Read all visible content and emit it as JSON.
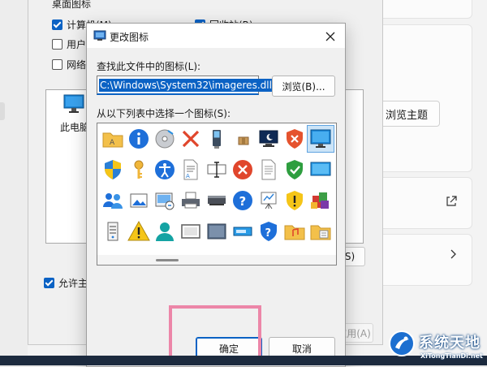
{
  "background_dialog": {
    "group_label": "桌面图标",
    "checkboxes": [
      {
        "label": "计算机(M)",
        "checked": true
      },
      {
        "label": "回收站(R)",
        "checked": true
      },
      {
        "label": "用户的",
        "checked": false
      },
      {
        "label": "网络(",
        "checked": false
      }
    ],
    "preview_label": "此电脑",
    "change_button_suffix": "S)",
    "allow_themes_label": "允许主题",
    "allow_themes_checked": true,
    "apply_label": "应用(A)"
  },
  "settings_panel": {
    "browse_themes_label": "浏览主题"
  },
  "dialog": {
    "title": "更改图标",
    "find_label": "查找此文件中的图标(L):",
    "path_value": "C:\\Windows\\System32\\imageres.dll",
    "browse_label": "浏览(B)...",
    "select_label": "从以下列表中选择一个图标(S):",
    "ok_label": "确定",
    "cancel_label": "取消",
    "icons": [
      "folder-icon",
      "info-icon",
      "cd-drive-icon",
      "red-x-icon",
      "usb-drive-icon",
      "package-icon",
      "sleep-monitor-icon",
      "shield-x-icon",
      "monitor-icon",
      "uac-shield-icon",
      "key-icon",
      "accessibility-icon",
      "document-icon",
      "text-cursor-icon",
      "error-icon",
      "blank-document-icon",
      "shield-check-icon",
      "display-icon",
      "users-icon",
      "picture-icon",
      "control-panel-icon",
      "printer-icon",
      "scanner-icon",
      "help-icon",
      "presentation-icon",
      "warning-shield-icon",
      "programs-icon",
      "server-icon",
      "warning-icon",
      "user-icon",
      "frame-icon",
      "panel-icon",
      "drive-icon",
      "shield-help-icon",
      "music-folder-icon",
      "documents-folder-icon"
    ],
    "selected_icon_index": 8
  },
  "colors": {
    "accent": "#0b62c4",
    "highlight": "#ec86a8",
    "dialog_bg": "#f0f0f0"
  },
  "watermark": {
    "title": "系统天地",
    "subtitle": "XiTongTianDi.net"
  }
}
